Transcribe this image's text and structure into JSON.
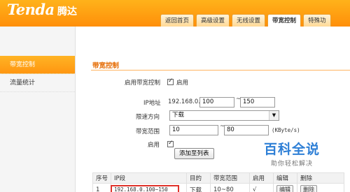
{
  "brand": {
    "logo": "Tenda",
    "name_cn": "腾达"
  },
  "tabs": [
    "返回首页",
    "高级设置",
    "无线设置",
    "带宽控制",
    "特殊功"
  ],
  "sidebar": {
    "items": [
      "带宽控制",
      "流量统计"
    ]
  },
  "section": {
    "title": "带宽控制"
  },
  "form": {
    "enable_label": "启用带宽控制",
    "enable_text": "启用",
    "ip_label": "IP地址",
    "ip_prefix": "192.168.0.",
    "ip_start": "100",
    "ip_sep": "~",
    "ip_end": "150",
    "dir_label": "限速方向",
    "dir_value": "下载",
    "range_label": "带宽范围",
    "range_min": "10",
    "range_sep": "~",
    "range_max": "80",
    "range_unit": "(KByte/s)",
    "row_enable_label": "启用",
    "add_button": "添加至列表"
  },
  "table": {
    "headers": [
      "序号",
      "IP段",
      "目的",
      "带宽范围",
      "启用",
      "编辑",
      "删除"
    ],
    "rows": [
      [
        "1",
        "192.168.0.100~150",
        "下载",
        "10~80",
        "√",
        "编辑",
        "删除"
      ]
    ]
  },
  "watermark": {
    "title": "百科全说",
    "subtitle": "助你轻松解决"
  },
  "colors": {
    "header": "#ff9f14",
    "accent": "#e56a00",
    "highlight": "#e0322a"
  }
}
